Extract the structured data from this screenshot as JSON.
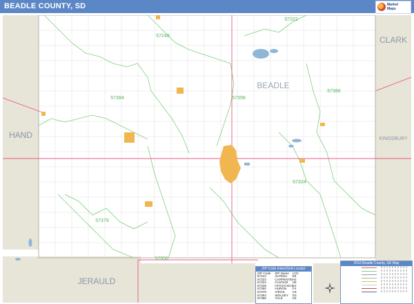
{
  "header": {
    "title": "BEADLE COUNTY, SD",
    "accent_color": "#5b87c6",
    "logo_icon": "map-publisher-logo"
  },
  "map": {
    "county_name": "BEADLE",
    "neighbors": {
      "north_east": "CLARK",
      "west": "HAND",
      "east": "KINGSBURY",
      "south_west": "JERAULD"
    },
    "zip_labels": [
      "57322",
      "57248",
      "57386",
      "57384",
      "57358",
      "57324",
      "57379",
      "57350"
    ],
    "colors": {
      "neighbor_fill": "#e7e4d8",
      "zip_boundary": "#7dd07d",
      "road": "#e85a8a",
      "water": "#8fb6d8",
      "city": "#f0b64f"
    }
  },
  "zip_index": {
    "title": "ZIP Code Index/Grid Locator",
    "columns": [
      "ZIP Code",
      "ZIP Name",
      "LOC"
    ],
    "rows": [
      [
        "57312",
        "ALPENA",
        "E8"
      ],
      [
        "57322",
        "CARPENTER",
        "H2"
      ],
      [
        "57324",
        "CAVOUR",
        "H5"
      ],
      [
        "57348",
        "HITCHCOCK",
        "D1"
      ],
      [
        "57350",
        "HURON",
        "F4"
      ],
      [
        "57379",
        "VIRGIL",
        "C8"
      ],
      [
        "57384",
        "WOLSEY",
        "D3"
      ],
      [
        "57386",
        "YALE",
        "H2"
      ]
    ]
  },
  "legend": {
    "title": "2016 Beadle County, SD Map"
  },
  "compass_icon": "compass-rose-icon"
}
